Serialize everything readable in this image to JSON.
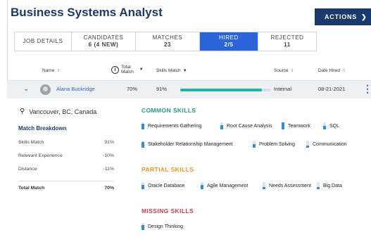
{
  "header": {
    "title": "Business Systems Analyst",
    "actions_label": "ACTIONS"
  },
  "tabs": [
    {
      "label": "JOB DETAILS",
      "count": ""
    },
    {
      "label": "CANDIDATES",
      "count": "6 (4 NEW)"
    },
    {
      "label": "MATCHES",
      "count": "23"
    },
    {
      "label": "HIRED",
      "count": "2/5"
    },
    {
      "label": "REJECTED",
      "count": "11"
    }
  ],
  "active_tab": "HIRED",
  "table": {
    "columns": {
      "name": "Name",
      "total_match_1": "Total",
      "total_match_2": "Match",
      "skills_match": "Skills Match",
      "source": "Source",
      "date_hired": "Date Hired"
    },
    "row": {
      "name": "Alana Buckridge",
      "total_match": "70%",
      "skills_match": "91%",
      "skills_match_fraction": 0.91,
      "source": "Internal",
      "date_hired": "08-21-2021"
    }
  },
  "detail": {
    "location": "Vancouver, BC, Canada",
    "match_breakdown": {
      "title": "Match Breakdown",
      "rows": [
        {
          "label": "Skills Match",
          "value": "91%"
        },
        {
          "label": "Relevant Experience",
          "value": "-10%"
        },
        {
          "label": "Distance",
          "value": "-11%"
        }
      ],
      "total_label": "Total Match",
      "total_value": "70%"
    },
    "common_skills": {
      "title": "COMMON SKILLS",
      "color": "#1e9e8a",
      "skills": [
        {
          "name": "Requirements Gathering",
          "level": 0.8
        },
        {
          "name": "Root Cause Analysis",
          "level": 0.6
        },
        {
          "name": "Teamwork",
          "level": 1.0
        },
        {
          "name": "SQL",
          "level": 0.5
        },
        {
          "name": "Stakeholder Relationship Management",
          "level": 0.8
        },
        {
          "name": "Problem Solving",
          "level": 0.5
        },
        {
          "name": "Communication",
          "level": 0.3
        }
      ]
    },
    "partial_skills": {
      "title": "PARTIAL SKILLS",
      "color": "#f0931a",
      "skills": [
        {
          "name": "Oracle Database",
          "level": 0.6
        },
        {
          "name": "Agile Management",
          "level": 0.6
        },
        {
          "name": "Needs Assessment",
          "level": 0.3
        },
        {
          "name": "Big Data",
          "level": 0.3
        }
      ]
    },
    "missing_skills": {
      "title": "MISSING SKILLS",
      "color": "#d13a47",
      "skills": [
        {
          "name": "Design Thinking",
          "level": 0.7
        }
      ]
    }
  },
  "colors": {
    "brand_navy": "#1b3a6b",
    "accent_blue": "#2b63d9",
    "match_bar": "#22b1a5",
    "skill_bar": "#2b8fd9"
  }
}
